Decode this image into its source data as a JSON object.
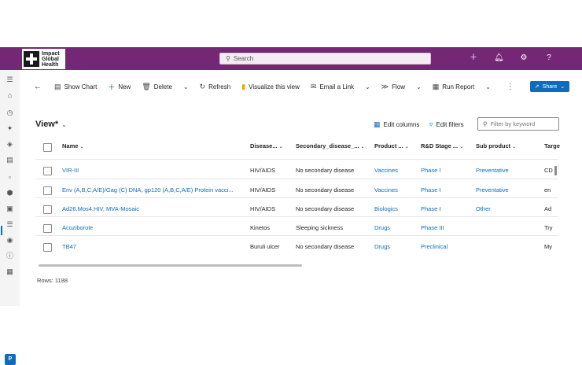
{
  "app": {
    "logo_text": [
      "Impact",
      "Global",
      "Health"
    ],
    "search_placeholder": "Search",
    "top_icons": [
      "plus-icon",
      "bell-icon",
      "gear-icon",
      "help-icon"
    ]
  },
  "commands": {
    "show_chart": "Show Chart",
    "new": "New",
    "delete": "Delete",
    "refresh": "Refresh",
    "visualize": "Visualize this view",
    "email_link": "Email a Link",
    "flow": "Flow",
    "run_report": "Run Report",
    "share": "Share"
  },
  "view": {
    "title": "View*",
    "edit_columns": "Edit columns",
    "edit_filters": "Edit filters",
    "filter_placeholder": "Filter by keyword"
  },
  "table": {
    "columns": [
      "Name",
      "Disease...",
      "Secondary_disease_...",
      "Product ...",
      "R&D Stage ...",
      "Sub product",
      "Targe"
    ],
    "rows": [
      [
        "VIR-III",
        "HIV/AIDS",
        "No secondary disease",
        "Vaccines",
        "Phase I",
        "Preventative",
        "CD"
      ],
      [
        "Env (A,B,C,A/E)/Gag (C) DNA, gp120 (A,B,C,A/E) Protein vacci...",
        "HIV/AIDS",
        "No secondary disease",
        "Vaccines",
        "Phase I",
        "Preventative",
        "en"
      ],
      [
        "Ad26.Mos4.HIV, MVA-Mosaic",
        "HIV/AIDS",
        "No secondary disease",
        "Biologics",
        "Phase I",
        "Other",
        "Ad"
      ],
      [
        "Acoziborole",
        "Kinetos",
        "Sleeping sickness",
        "Drugs",
        "Phase III",
        "",
        "Try"
      ],
      [
        "TB47",
        "Buruli ulcer",
        "No secondary disease",
        "Drugs",
        "Preclinical",
        "",
        "My"
      ]
    ],
    "rows_label": "Rows: 1188"
  },
  "user_initial": "P",
  "colors": {
    "brand": "#742774",
    "accent": "#0f6cbd"
  }
}
